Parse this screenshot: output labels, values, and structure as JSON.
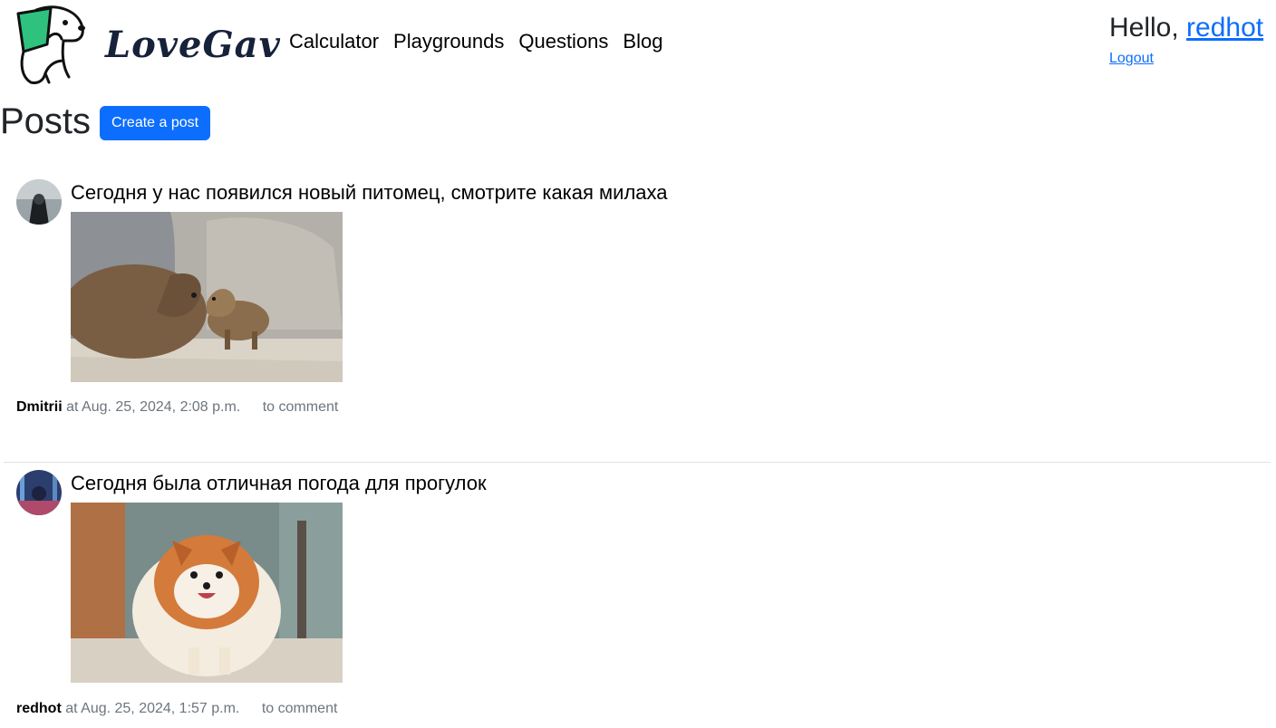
{
  "brand": {
    "name": "LoveGav"
  },
  "nav": {
    "items": [
      "Calculator",
      "Playgrounds",
      "Questions",
      "Blog"
    ]
  },
  "user": {
    "greeting": "Hello,",
    "username": "redhot",
    "logout": "Logout"
  },
  "page": {
    "title": "Posts",
    "create_button": "Create a post"
  },
  "posts": [
    {
      "title": "Сегодня у нас появился новый питомец, смотрите какая милаха",
      "author": "Dmitrii",
      "date": "at Aug. 25, 2024, 2:08 p.m.",
      "comment": "to comment"
    },
    {
      "title": "Сегодня была отличная погода для прогулок",
      "author": "redhot",
      "date": "at Aug. 25, 2024, 1:57 p.m.",
      "comment": "to comment"
    }
  ],
  "colors": {
    "primary": "#0d6efd",
    "brand_green": "#2ec27e",
    "brand_dark": "#16213a"
  }
}
